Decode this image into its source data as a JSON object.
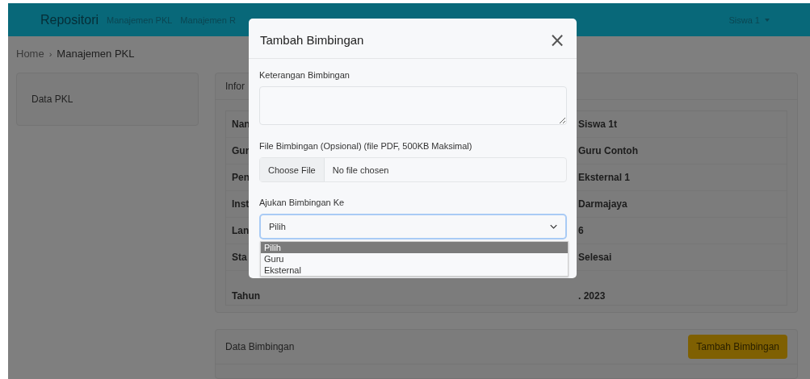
{
  "navbar": {
    "brand": "Repositori",
    "links": [
      {
        "label": "Manajemen PKL"
      },
      {
        "label": "Manajemen R"
      }
    ],
    "user_menu": "Siswa 1"
  },
  "breadcrumb": {
    "separator": "›",
    "items": [
      "Home",
      "Manajemen PKL"
    ]
  },
  "sidebar": {
    "items": [
      {
        "label": "Data PKL"
      }
    ]
  },
  "info_card": {
    "title": "Infor",
    "rows": [
      {
        "label": "Nan",
        "value": "Siswa 1t"
      },
      {
        "label": "Gur",
        "value": "Guru Contoh"
      },
      {
        "label": "Pen",
        "value": "Eksternal 1"
      },
      {
        "label": "Inst",
        "value": "Darmajaya"
      },
      {
        "label": "Lan",
        "value": "6"
      },
      {
        "label": "Sta",
        "value": "Selesai"
      },
      {
        "label": "Tahun",
        "value": ". 2023"
      }
    ]
  },
  "guidance_card": {
    "title": "Data Bimbingan",
    "button": "Tambah Bimbingan"
  },
  "modal": {
    "title": "Tambah Bimbingan",
    "close": "×",
    "description_label": "Keterangan Bimbingan",
    "file_label": "File Bimbingan (Opsional) (file PDF, 500KB Maksimal)",
    "file_button": "Choose File",
    "file_status": "No file chosen",
    "target_label": "Ajukan Bimbingan Ke",
    "target_value": "Pilih",
    "target_options": [
      {
        "label": "Pilih",
        "selected": true
      },
      {
        "label": "Guru",
        "selected": false
      },
      {
        "label": "Eksternal",
        "selected": false
      }
    ]
  }
}
